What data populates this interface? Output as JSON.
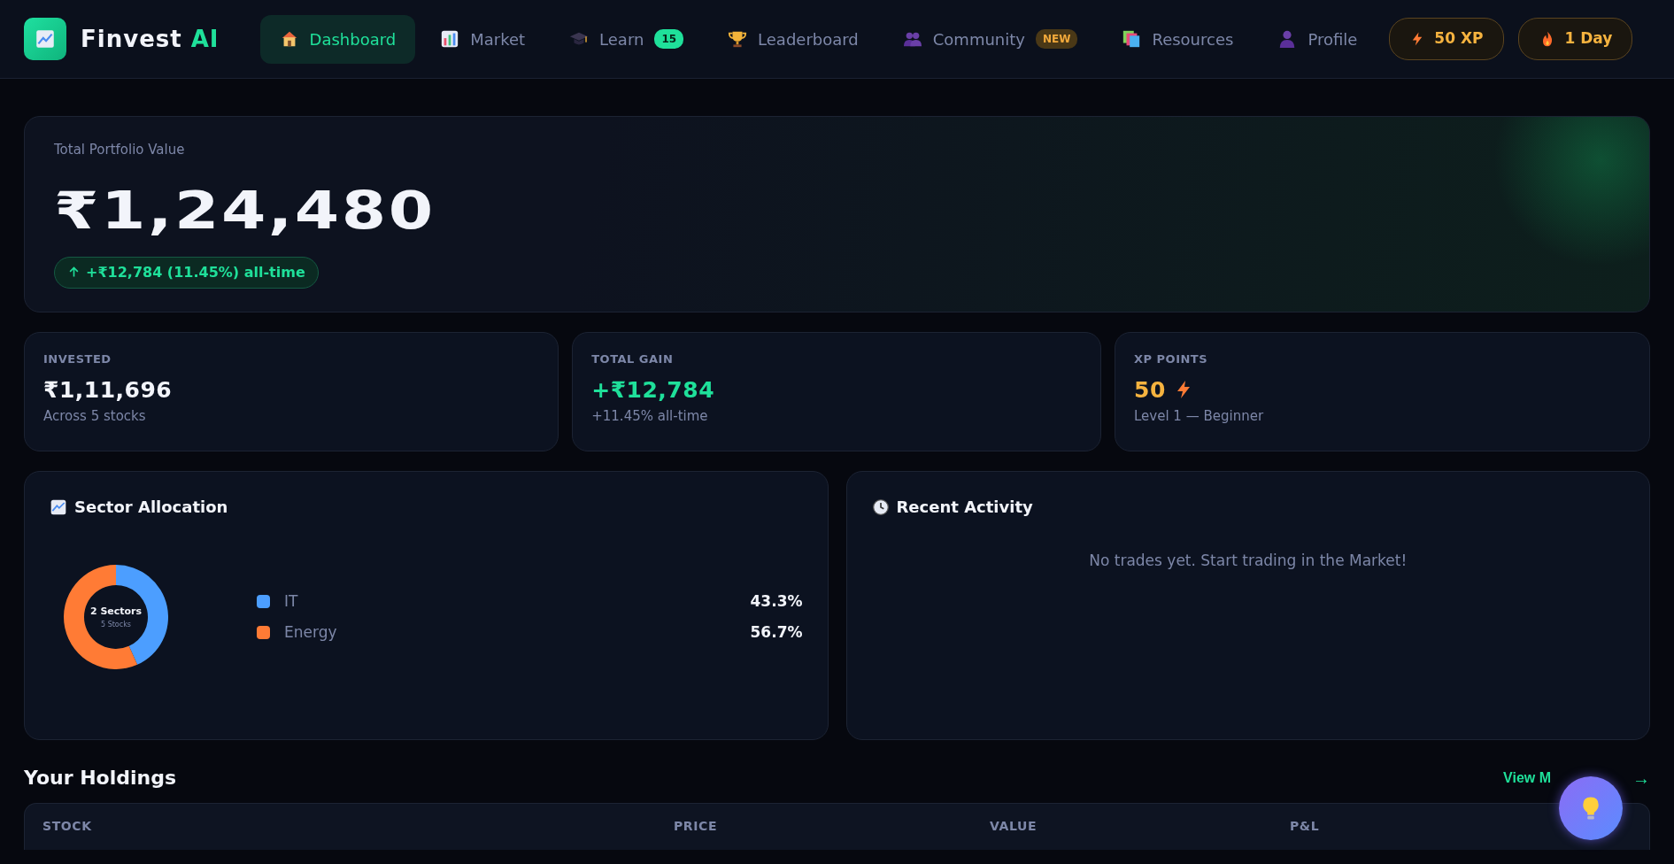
{
  "brand": {
    "name": "Finvest",
    "accent": "AI"
  },
  "nav": [
    {
      "label": "Dashboard",
      "selected": true
    },
    {
      "label": "Market",
      "selected": false
    },
    {
      "label": "Learn",
      "selected": false,
      "badge": {
        "text": "15",
        "kind": "count"
      }
    },
    {
      "label": "Leaderboard",
      "selected": false
    },
    {
      "label": "Community",
      "selected": false,
      "badge": {
        "text": "NEW",
        "kind": "new"
      }
    },
    {
      "label": "Resources",
      "selected": false
    },
    {
      "label": "Profile",
      "selected": false
    }
  ],
  "pills": [
    {
      "kind": "xp",
      "label": "50 XP"
    },
    {
      "kind": "streak",
      "label": "1 Day"
    }
  ],
  "portfolio": {
    "label": "Total Portfolio Value",
    "value": "₹1,24,480",
    "change": "+₹12,784 (11.45%) all-time"
  },
  "stats": [
    {
      "label": "INVESTED",
      "value": "₹1,11,696",
      "sub": "Across 5 stocks",
      "kind": "neutral"
    },
    {
      "label": "TOTAL GAIN",
      "value": "+₹12,784",
      "sub": "+11.45% all-time",
      "kind": "positive"
    },
    {
      "label": "XP POINTS",
      "value": "50",
      "sub": "Level 1 — Beginner",
      "kind": "xp"
    }
  ],
  "sector": {
    "title": "Sector Allocation",
    "center_title": "2 Sectors",
    "center_sub": "5 Stocks",
    "chart_data": {
      "type": "donut",
      "categories": [
        "IT",
        "Energy"
      ],
      "values": [
        43.3,
        56.7
      ]
    },
    "legend": [
      {
        "value": "43.3%",
        "color": "#4c9eff"
      },
      {
        "value": "56.7%",
        "color": "#ff7b35"
      }
    ]
  },
  "activity": {
    "title": "Recent Activity",
    "empty": "No trades yet. Start trading in the Market!"
  },
  "holdings": {
    "title": "Your Holdings",
    "link": "View M",
    "link_arrow": "→",
    "columns": [
      "STOCK",
      "PRICE",
      "VALUE",
      "P&L"
    ]
  }
}
